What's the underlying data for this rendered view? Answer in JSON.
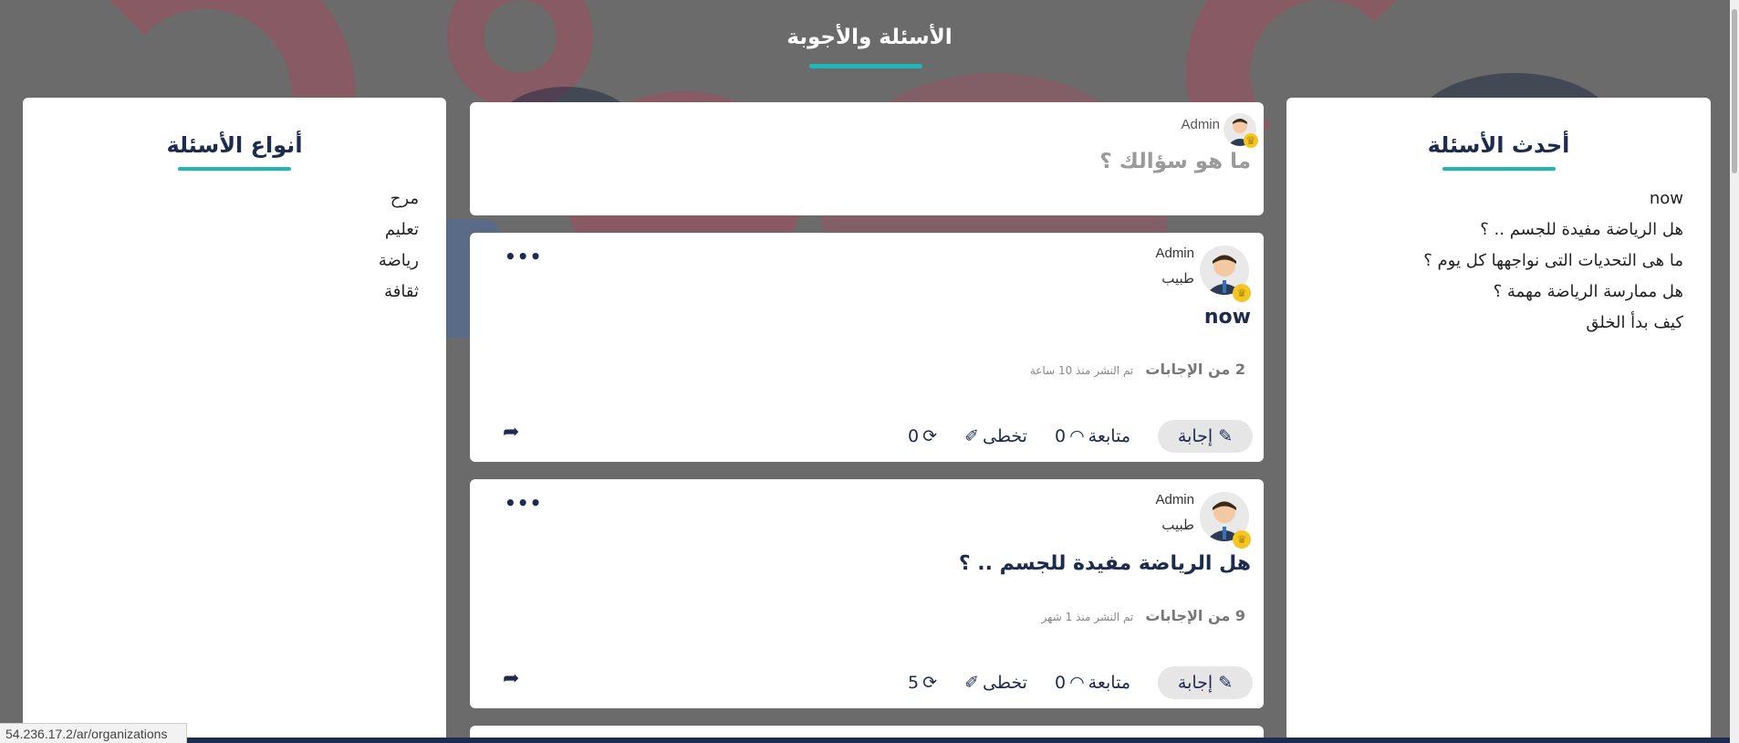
{
  "page": {
    "title": "الأسئلة والأجوبة"
  },
  "latest": {
    "title": "أحدث الأسئلة",
    "items": [
      "now",
      "هل الرياضة مفيدة للجسم .. ؟",
      "ما هى التحديات التى نواجهها كل يوم ؟",
      "هل ممارسة الرياضة مهمة ؟",
      "كيف بدأ الخلق"
    ]
  },
  "categories": {
    "title": "أنواع الأسئلة",
    "items": [
      "مرح",
      "تعليم",
      "رياضة",
      "ثقافة"
    ]
  },
  "ask": {
    "author": "Admin",
    "placeholder": "ما هو سؤالك ؟"
  },
  "questions": [
    {
      "author": "Admin",
      "role": "طبيب",
      "title": "now",
      "answers": "2 من الإجابات",
      "posted": "تم النشر منذ 10 ساعة",
      "answer_label": "إجابة",
      "follow_count": "0",
      "follow_label": "متابعة",
      "skip_label": "تخطى",
      "refresh_count": "0"
    },
    {
      "author": "Admin",
      "role": "طبيب",
      "title": "هل الرياضة مفيدة للجسم .. ؟",
      "answers": "9 من الإجابات",
      "posted": "تم النشر منذ 1 شهر",
      "answer_label": "إجابة",
      "follow_count": "0",
      "follow_label": "متابعة",
      "skip_label": "تخطى",
      "refresh_count": "5"
    }
  ],
  "status_bar": {
    "url": "54.236.17.2/ar/organizations"
  },
  "icons": {
    "more": "more-dots-icon",
    "pencil": "pencil-icon",
    "rss": "rss-icon",
    "skip": "pencil-slash-icon",
    "refresh": "refresh-icon",
    "share": "share-icon",
    "crown": "crown-icon"
  },
  "colors": {
    "accent": "#1fb6b6",
    "navy": "#1d2b4f",
    "badge": "#f3c623"
  }
}
